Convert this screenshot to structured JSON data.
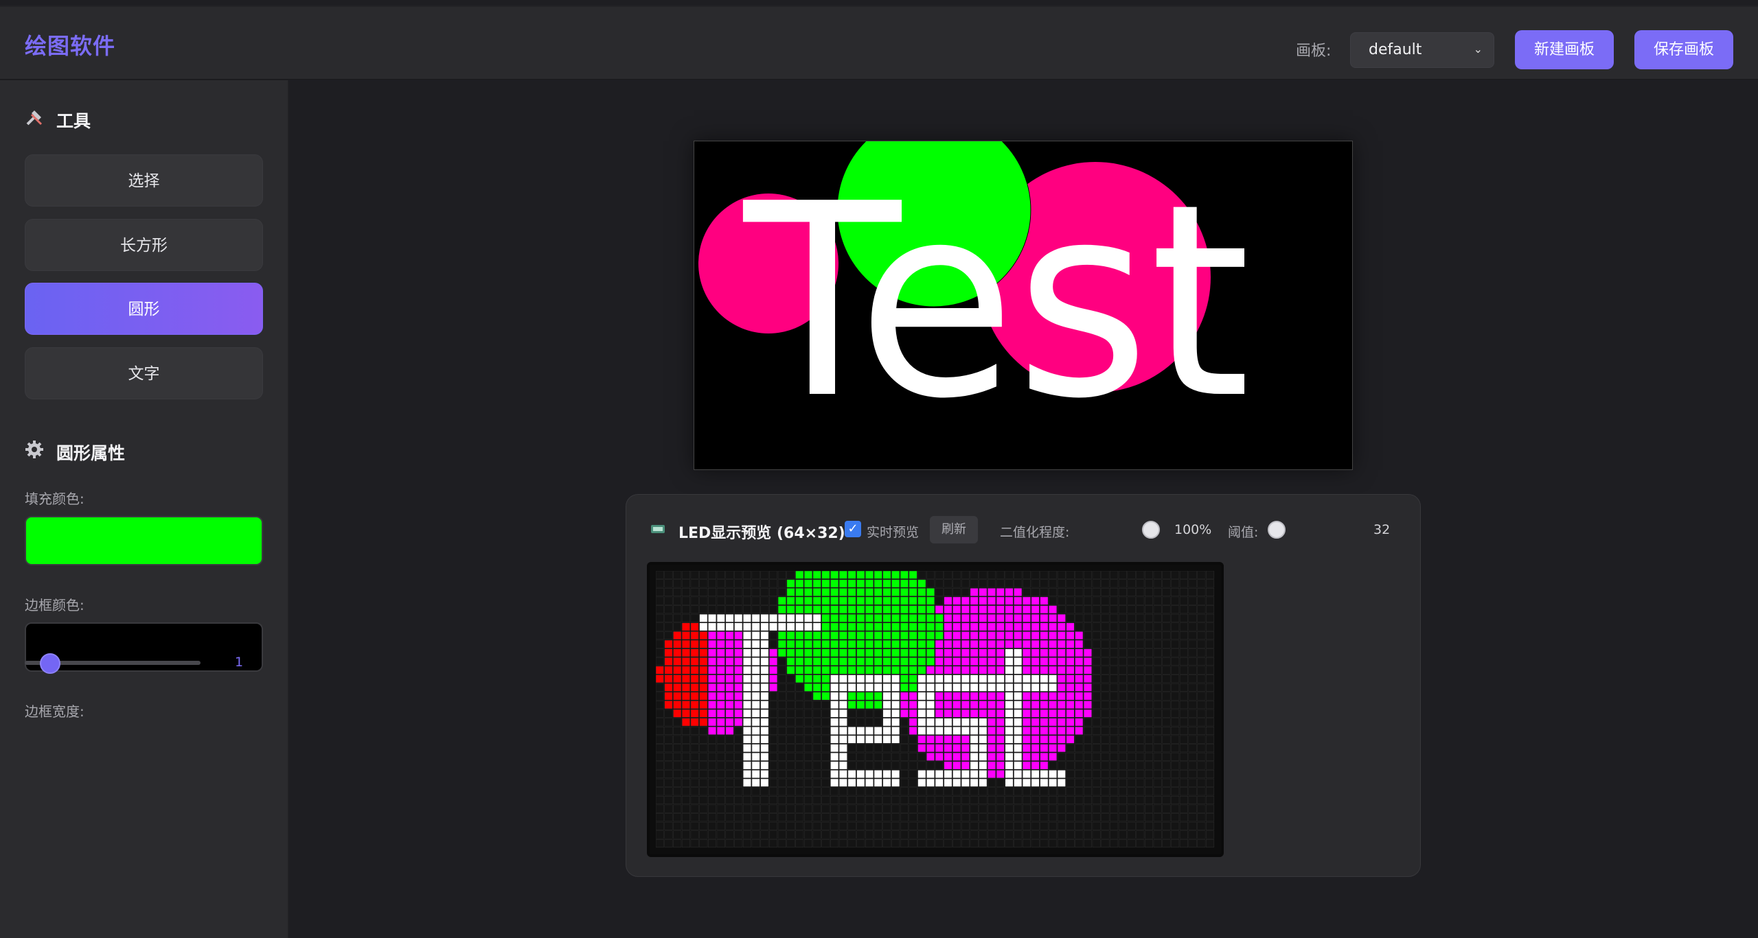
{
  "header": {
    "app_title": "绘图软件",
    "board_label": "画板:",
    "board_select_value": "default",
    "new_board_button": "新建画板",
    "save_board_button": "保存画板"
  },
  "sidebar": {
    "tools_title": "工具",
    "tools": [
      {
        "label": "选择",
        "active": false
      },
      {
        "label": "长方形",
        "active": false
      },
      {
        "label": "圆形",
        "active": true
      },
      {
        "label": "文字",
        "active": false
      }
    ],
    "props_title": "圆形属性",
    "fill_color_label": "填充颜色:",
    "fill_color": "#00ff00",
    "border_color_label": "边框颜色:",
    "border_color": "#000000",
    "border_width_label": "边框宽度:",
    "border_width_value": "1"
  },
  "canvas": {
    "text": "Test",
    "text_color": "#ffffff",
    "background": "#000000",
    "circle_colors": [
      "#ff0080",
      "#00ff00",
      "#ff0080"
    ]
  },
  "led_preview": {
    "title": "LED显示预览 (64×32)",
    "realtime_label": "实时预览",
    "realtime_checked": true,
    "refresh_button": "刷新",
    "binarize_label": "二值化程度:",
    "binarize_value": "100%",
    "threshold_label": "阈值:",
    "threshold_value": "32"
  },
  "colors": {
    "accent": "#7b6cf6",
    "led_red": "#ff0000",
    "led_green": "#00ff00",
    "led_magenta": "#ff00ff",
    "led_yellow": "#ffff00",
    "led_white": "#ffffff"
  }
}
